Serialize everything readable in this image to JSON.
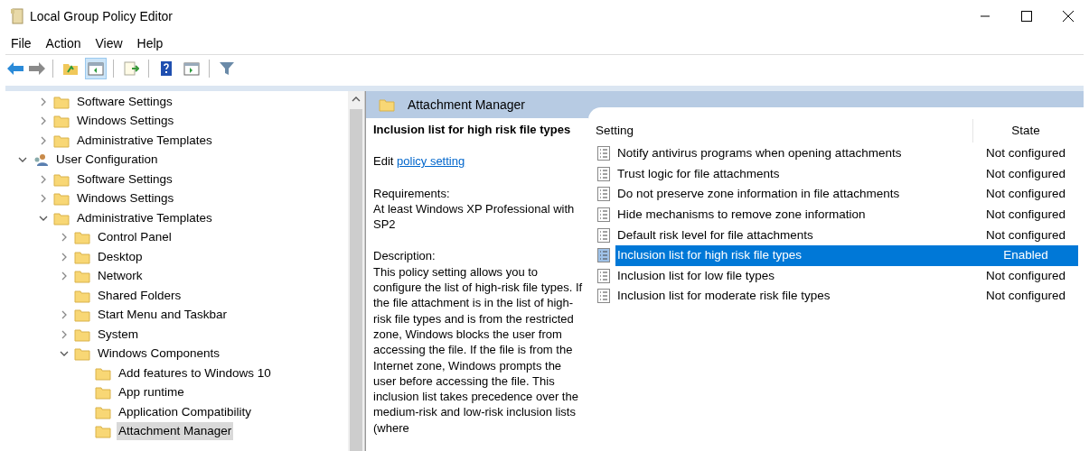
{
  "window": {
    "title": "Local Group Policy Editor"
  },
  "menu": [
    "File",
    "Action",
    "View",
    "Help"
  ],
  "toolbar": [
    {
      "kind": "back",
      "disabled": false
    },
    {
      "kind": "forward",
      "disabled": true
    },
    {
      "kind": "sep"
    },
    {
      "kind": "up",
      "selected": false
    },
    {
      "kind": "tree",
      "selected": true
    },
    {
      "kind": "sep"
    },
    {
      "kind": "export",
      "selected": false
    },
    {
      "kind": "sep"
    },
    {
      "kind": "help",
      "selected": false
    },
    {
      "kind": "pane",
      "selected": false
    },
    {
      "kind": "sep"
    },
    {
      "kind": "filter",
      "selected": false
    }
  ],
  "tree": [
    {
      "kind": "continuation",
      "children": [
        {
          "kind": "folder",
          "label": "Software Settings",
          "expanded": false,
          "selected": false
        },
        {
          "kind": "folder",
          "label": "Windows Settings",
          "expanded": false,
          "selected": false
        },
        {
          "kind": "folder",
          "label": "Administrative Templates",
          "expanded": false,
          "selected": false
        }
      ]
    },
    {
      "kind": "user",
      "label": "User Configuration",
      "expanded": true,
      "selected": false,
      "children": [
        {
          "kind": "folder",
          "label": "Software Settings",
          "expanded": false,
          "selected": false
        },
        {
          "kind": "folder",
          "label": "Windows Settings",
          "expanded": false,
          "selected": false
        },
        {
          "kind": "folder",
          "label": "Administrative Templates",
          "expanded": true,
          "selected": false,
          "children": [
            {
              "kind": "folder",
              "label": "Control Panel",
              "expanded": false,
              "selected": false
            },
            {
              "kind": "folder",
              "label": "Desktop",
              "expanded": false,
              "selected": false
            },
            {
              "kind": "folder",
              "label": "Network",
              "expanded": false,
              "selected": false
            },
            {
              "kind": "leaf",
              "label": "Shared Folders",
              "selected": false
            },
            {
              "kind": "folder",
              "label": "Start Menu and Taskbar",
              "expanded": false,
              "selected": false
            },
            {
              "kind": "folder",
              "label": "System",
              "expanded": false,
              "selected": false
            },
            {
              "kind": "folder",
              "label": "Windows Components",
              "expanded": true,
              "selected": false,
              "children": [
                {
                  "kind": "leaf",
                  "label": "Add features to Windows 10",
                  "selected": false
                },
                {
                  "kind": "leaf",
                  "label": "App runtime",
                  "selected": false
                },
                {
                  "kind": "leaf",
                  "label": "Application Compatibility",
                  "selected": false
                },
                {
                  "kind": "leaf",
                  "label": "Attachment Manager",
                  "selected": true
                }
              ]
            }
          ]
        }
      ]
    }
  ],
  "details": {
    "header": "Attachment Manager",
    "title": "Inclusion list for high risk file types",
    "edit_prefix": "Edit",
    "edit_link": "policy setting",
    "requirements_label": "Requirements:",
    "requirements": "At least Windows XP Professional with SP2",
    "description_label": "Description:",
    "description": "This policy setting allows you to configure the list of high-risk file types. If the file attachment is in the list of high-risk file types and is from the restricted zone, Windows blocks the user from accessing the file. If the file is from the Internet zone, Windows prompts the user before accessing the file. This inclusion list takes precedence over the medium-risk and low-risk inclusion lists (where"
  },
  "table": {
    "columns": [
      "Setting",
      "State"
    ],
    "rows": [
      {
        "setting": "Notify antivirus programs when opening attachments",
        "state": "Not configured",
        "selected": false
      },
      {
        "setting": "Trust logic for file attachments",
        "state": "Not configured",
        "selected": false
      },
      {
        "setting": "Do not preserve zone information in file attachments",
        "state": "Not configured",
        "selected": false
      },
      {
        "setting": "Hide mechanisms to remove zone information",
        "state": "Not configured",
        "selected": false
      },
      {
        "setting": "Default risk level for file attachments",
        "state": "Not configured",
        "selected": false
      },
      {
        "setting": "Inclusion list for high risk file types",
        "state": "Enabled",
        "selected": true
      },
      {
        "setting": "Inclusion list for low file types",
        "state": "Not configured",
        "selected": false
      },
      {
        "setting": "Inclusion list for moderate risk file types",
        "state": "Not configured",
        "selected": false
      }
    ]
  }
}
